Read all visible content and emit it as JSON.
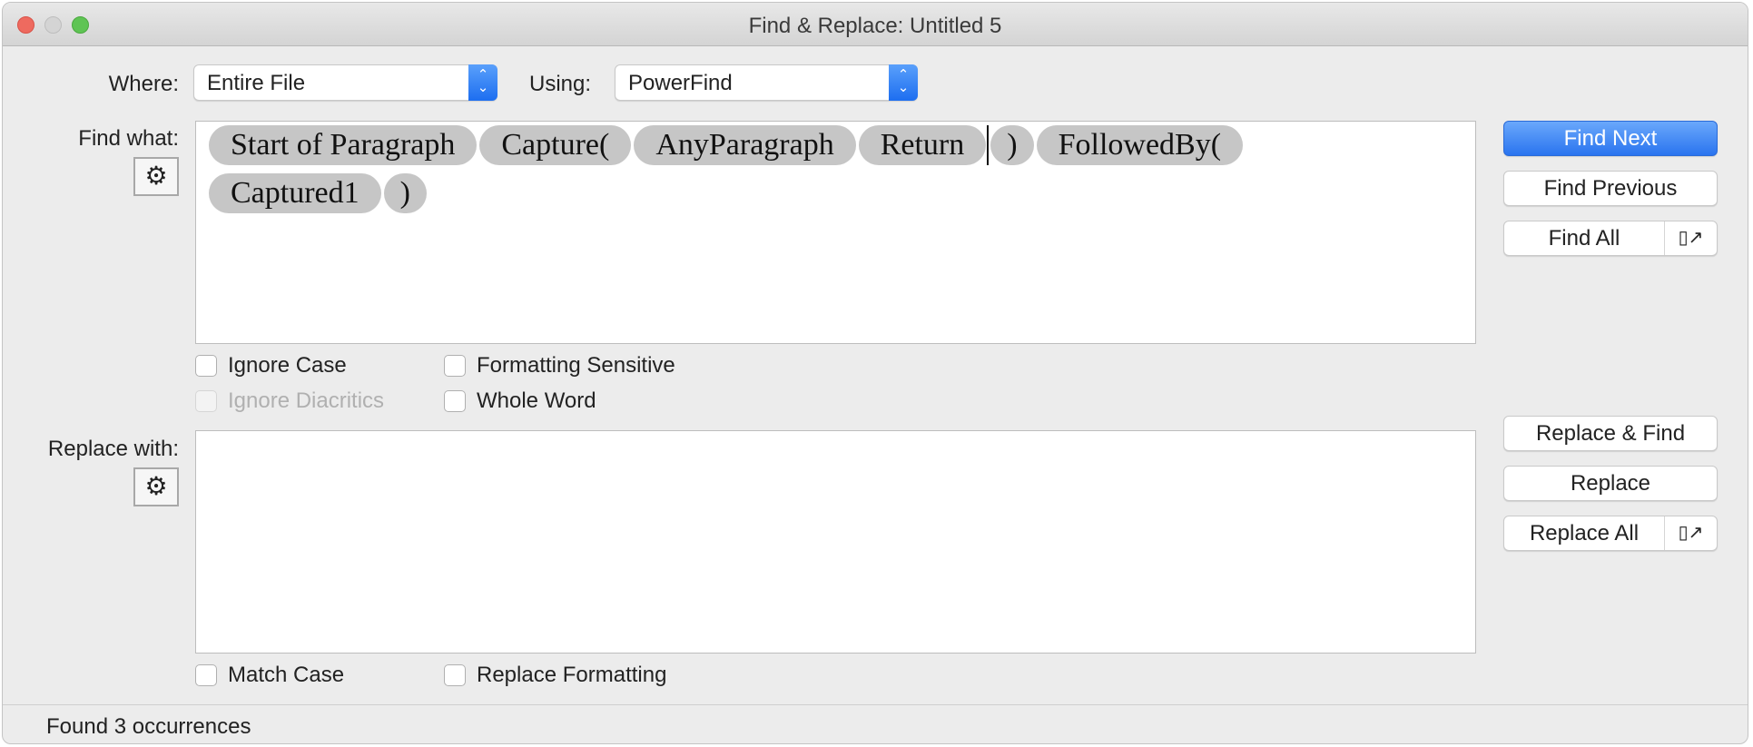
{
  "window": {
    "title": "Find & Replace: Untitled 5"
  },
  "where": {
    "label": "Where:",
    "value": "Entire File"
  },
  "using": {
    "label": "Using:",
    "value": "PowerFind"
  },
  "find": {
    "label": "Find what:",
    "tokens_row1": [
      "Start of Paragraph",
      "Capture(",
      "AnyParagraph",
      "Return",
      ")",
      "FollowedBy("
    ],
    "tokens_row2": [
      "Captured1",
      ")"
    ]
  },
  "find_options": {
    "ignore_case": "Ignore Case",
    "formatting_sensitive": "Formatting Sensitive",
    "ignore_diacritics": "Ignore Diacritics",
    "whole_word": "Whole Word"
  },
  "replace": {
    "label": "Replace with:",
    "value": ""
  },
  "replace_options": {
    "match_case": "Match Case",
    "replace_formatting": "Replace Formatting"
  },
  "buttons": {
    "find_next": "Find Next",
    "find_previous": "Find Previous",
    "find_all": "Find All",
    "replace_and_find": "Replace & Find",
    "replace": "Replace",
    "replace_all": "Replace All"
  },
  "status": "Found 3 occurrences",
  "colors": {
    "accent": "#2a74ef",
    "token": "#c6c6c6"
  }
}
